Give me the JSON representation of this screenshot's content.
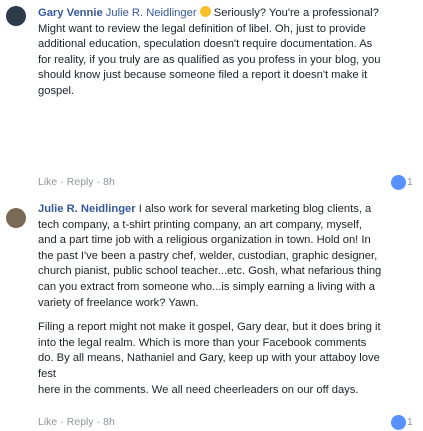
{
  "comments": [
    {
      "author": "Gary Vennie",
      "text_a": "Julie R. Neidlinger",
      "text_b": "Seriously? You're a professional? Might want to review the legal definition of libel. Oh, just to provide additional education, speculation doesn't require documentation. As for reality, if you truly are as qualified as you profess in your blog, you should know just because someone filed a report it doesn't make it gospel.",
      "like": "Like",
      "reply": "Reply",
      "sep": "·",
      "time": "8h",
      "reactions": "1"
    },
    {
      "author": "Julie R. Neidlinger",
      "para1": "I also work for several marketing blog clients, a tech company, a t-shirt printing company, an art company, myself, and a part time job with a religious organization in town. Hold on! In the past I've been a pastry chef, welder, custodian, graphic designer, church pianist, public school teacher...etc. Gosh, what nefarious thing can you extract from someone who...is simply earning a living with a variety of freelance work? Yawn.",
      "para2": "Filing a report might not make it gospel, Gary dear, but it does bring it into the legal realm. Which is more than your Facebook comments do. By all means, Nathaniel and Gary, keep up with your attaboy love fest",
      "para3": "here in the comments. We all need cheerleaders on our off days.",
      "like": "Like",
      "reply": "Reply",
      "sep": "·",
      "time": "8h",
      "reactions": "1"
    }
  ],
  "icons": {
    "reaction": "like-reaction-icon",
    "emoji": "grimace-emoji-icon"
  },
  "colors": {
    "author": "#365899",
    "meta": "#90949c",
    "like": "#5890ff"
  }
}
